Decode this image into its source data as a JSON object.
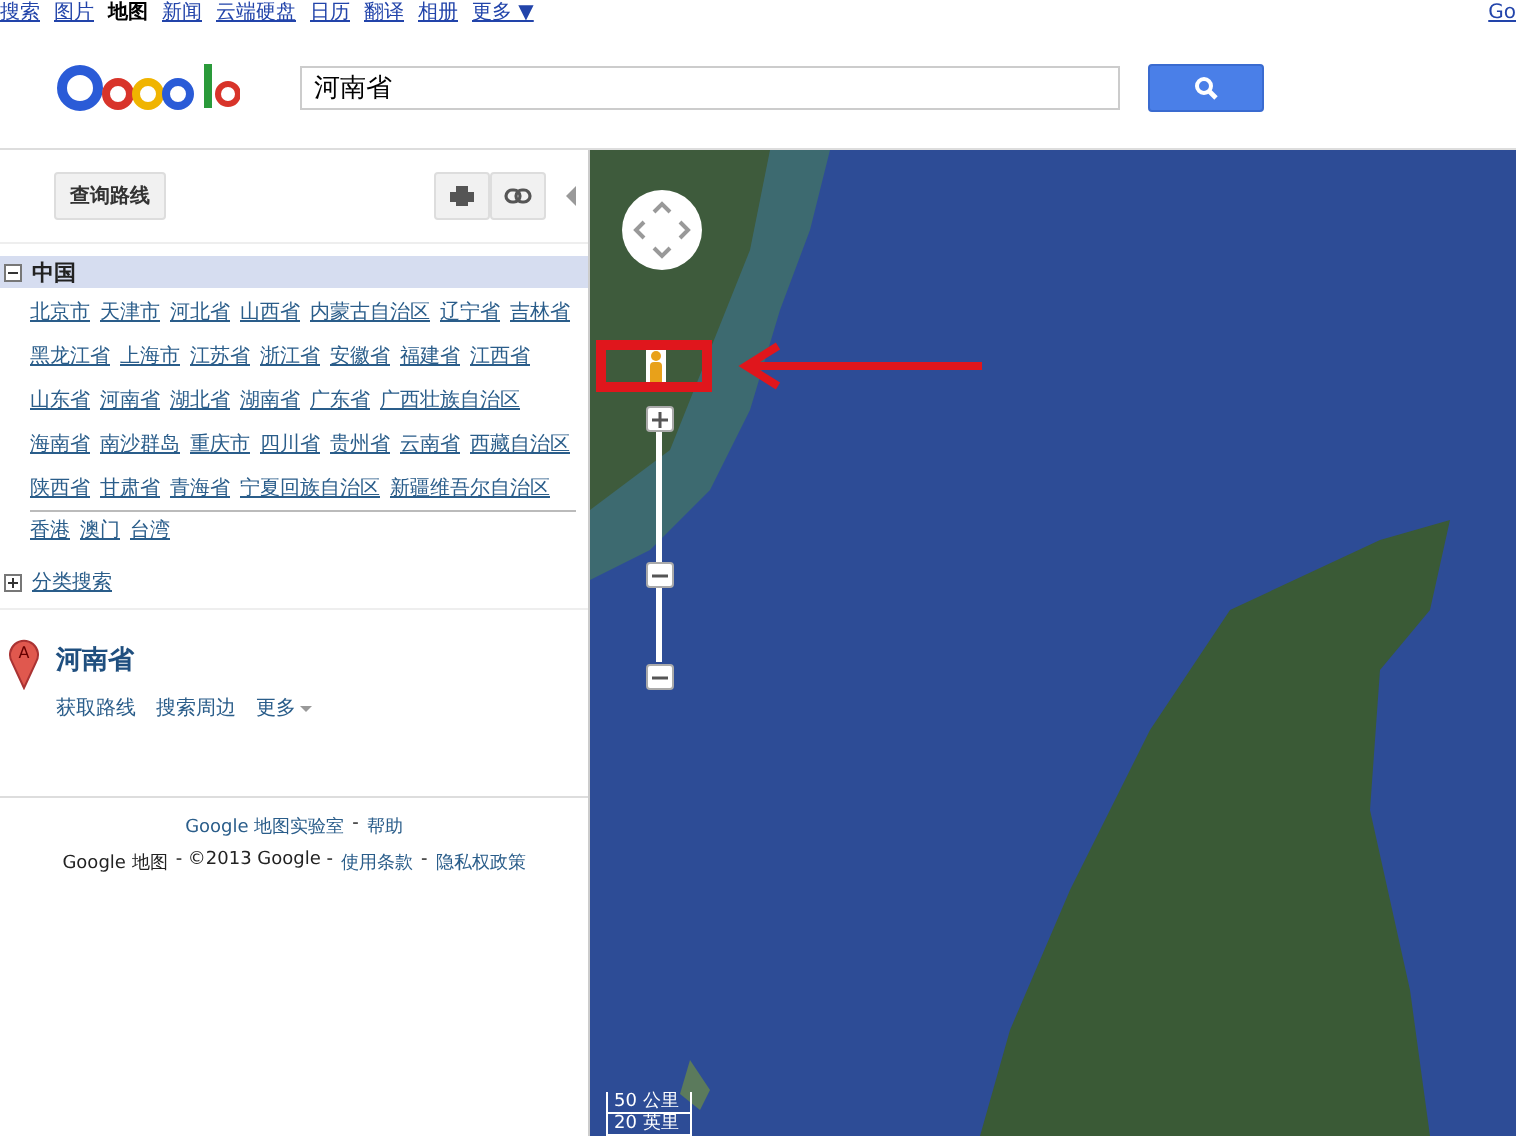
{
  "top_nav": {
    "items": [
      {
        "label": "搜索",
        "selected": false
      },
      {
        "label": "图片",
        "selected": false
      },
      {
        "label": "地图",
        "selected": true
      },
      {
        "label": "新闻",
        "selected": false
      },
      {
        "label": "云端硬盘",
        "selected": false
      },
      {
        "label": "日历",
        "selected": false
      },
      {
        "label": "翻译",
        "selected": false
      },
      {
        "label": "相册",
        "selected": false
      },
      {
        "label": "更多 ▼",
        "selected": false
      }
    ],
    "account_link": "Go"
  },
  "search": {
    "value": "河南省"
  },
  "sidebar": {
    "directions_button": "查询路线",
    "region": {
      "title": "中国",
      "expanded": true,
      "provinces": [
        "北京市",
        "天津市",
        "河北省",
        "山西省",
        "内蒙古自治区",
        "辽宁省",
        "吉林省",
        "黑龙江省",
        "上海市",
        "江苏省",
        "浙江省",
        "安徽省",
        "福建省",
        "江西省",
        "山东省",
        "河南省",
        "湖北省",
        "湖南省",
        "广东省",
        "广西壮族自治区",
        "海南省",
        "南沙群岛",
        "重庆市",
        "四川省",
        "贵州省",
        "云南省",
        "西藏自治区",
        "陕西省",
        "甘肃省",
        "青海省",
        "宁夏回族自治区",
        "新疆维吾尔自治区"
      ],
      "special": [
        "香港",
        "澳门",
        "台湾"
      ]
    },
    "category_search": {
      "label": "分类搜索",
      "expanded": false
    },
    "result": {
      "marker": "A",
      "title": "河南省",
      "actions": [
        "获取路线",
        "搜索周边",
        "更多"
      ]
    },
    "footer": [
      [
        {
          "kind": "link",
          "text": "Google 地图实验室"
        },
        {
          "kind": "text",
          "text": "-"
        },
        {
          "kind": "link",
          "text": "帮助"
        }
      ],
      [
        {
          "kind": "text",
          "text": "Google 地图"
        },
        {
          "kind": "text",
          "text": "- ©2013 Google -"
        },
        {
          "kind": "link",
          "text": "使用条款"
        },
        {
          "kind": "text",
          "text": "-"
        },
        {
          "kind": "link",
          "text": "隐私权政策"
        }
      ]
    ]
  },
  "map": {
    "zoom": {
      "level": 0.38
    },
    "scale": [
      "50 公里",
      "20 英里"
    ]
  }
}
